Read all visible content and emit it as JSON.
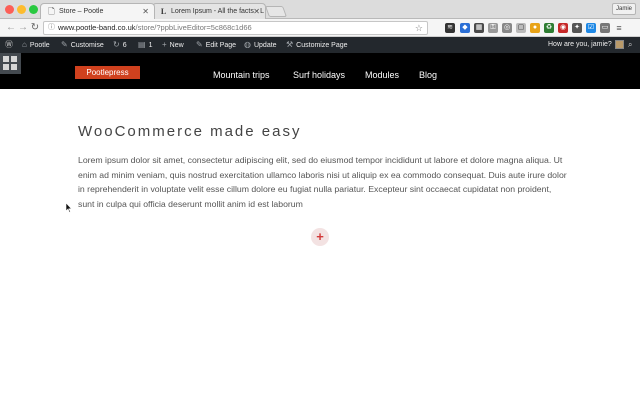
{
  "browser": {
    "tabs": [
      {
        "title": "Store – Pootle",
        "favicon": "pootle-favicon",
        "active": true
      },
      {
        "title": "Lorem Ipsum - All the facts - L",
        "favicon": "lorem-ipsum-favicon",
        "active": false
      }
    ],
    "user_chip": "Jamie",
    "address": {
      "domain": "www.pootle-band.co.uk",
      "path": "/store/?ppbLiveEditor=5c868c1d66"
    }
  },
  "admin_bar": {
    "site_name": "Pootle",
    "customise": "Customise",
    "updates_count": "6",
    "comments_count": "1",
    "new_label": "New",
    "edit_page": "Edit Page",
    "update": "Update",
    "customize_page": "Customize Page",
    "greeting": "How are you, jamie?"
  },
  "site": {
    "logo": "Pootlepress",
    "nav": [
      "Mountain trips",
      "Surf holidays",
      "Modules",
      "Blog"
    ]
  },
  "content": {
    "title": "WooCommerce made easy",
    "paragraph": "Lorem ipsum dolor sit amet, consectetur adipiscing elit, sed do eiusmod tempor incididunt ut labore et dolore magna aliqua. Ut enim ad minim veniam, quis nostrud exercitation ullamco laboris nisi ut aliquip ex ea commodo consequat. Duis aute irure dolor in reprehenderit in voluptate velit esse cillum dolore eu fugiat nulla pariatur. Excepteur sint occaecat cupidatat non proident, sunt in culpa qui officia deserunt mollit anim id est laborum",
    "add_button": "+"
  },
  "colors": {
    "admin_bar": "#23282d",
    "header": "#000000",
    "logo_accent": "#d0411e",
    "add_button": "#d23a3a"
  }
}
